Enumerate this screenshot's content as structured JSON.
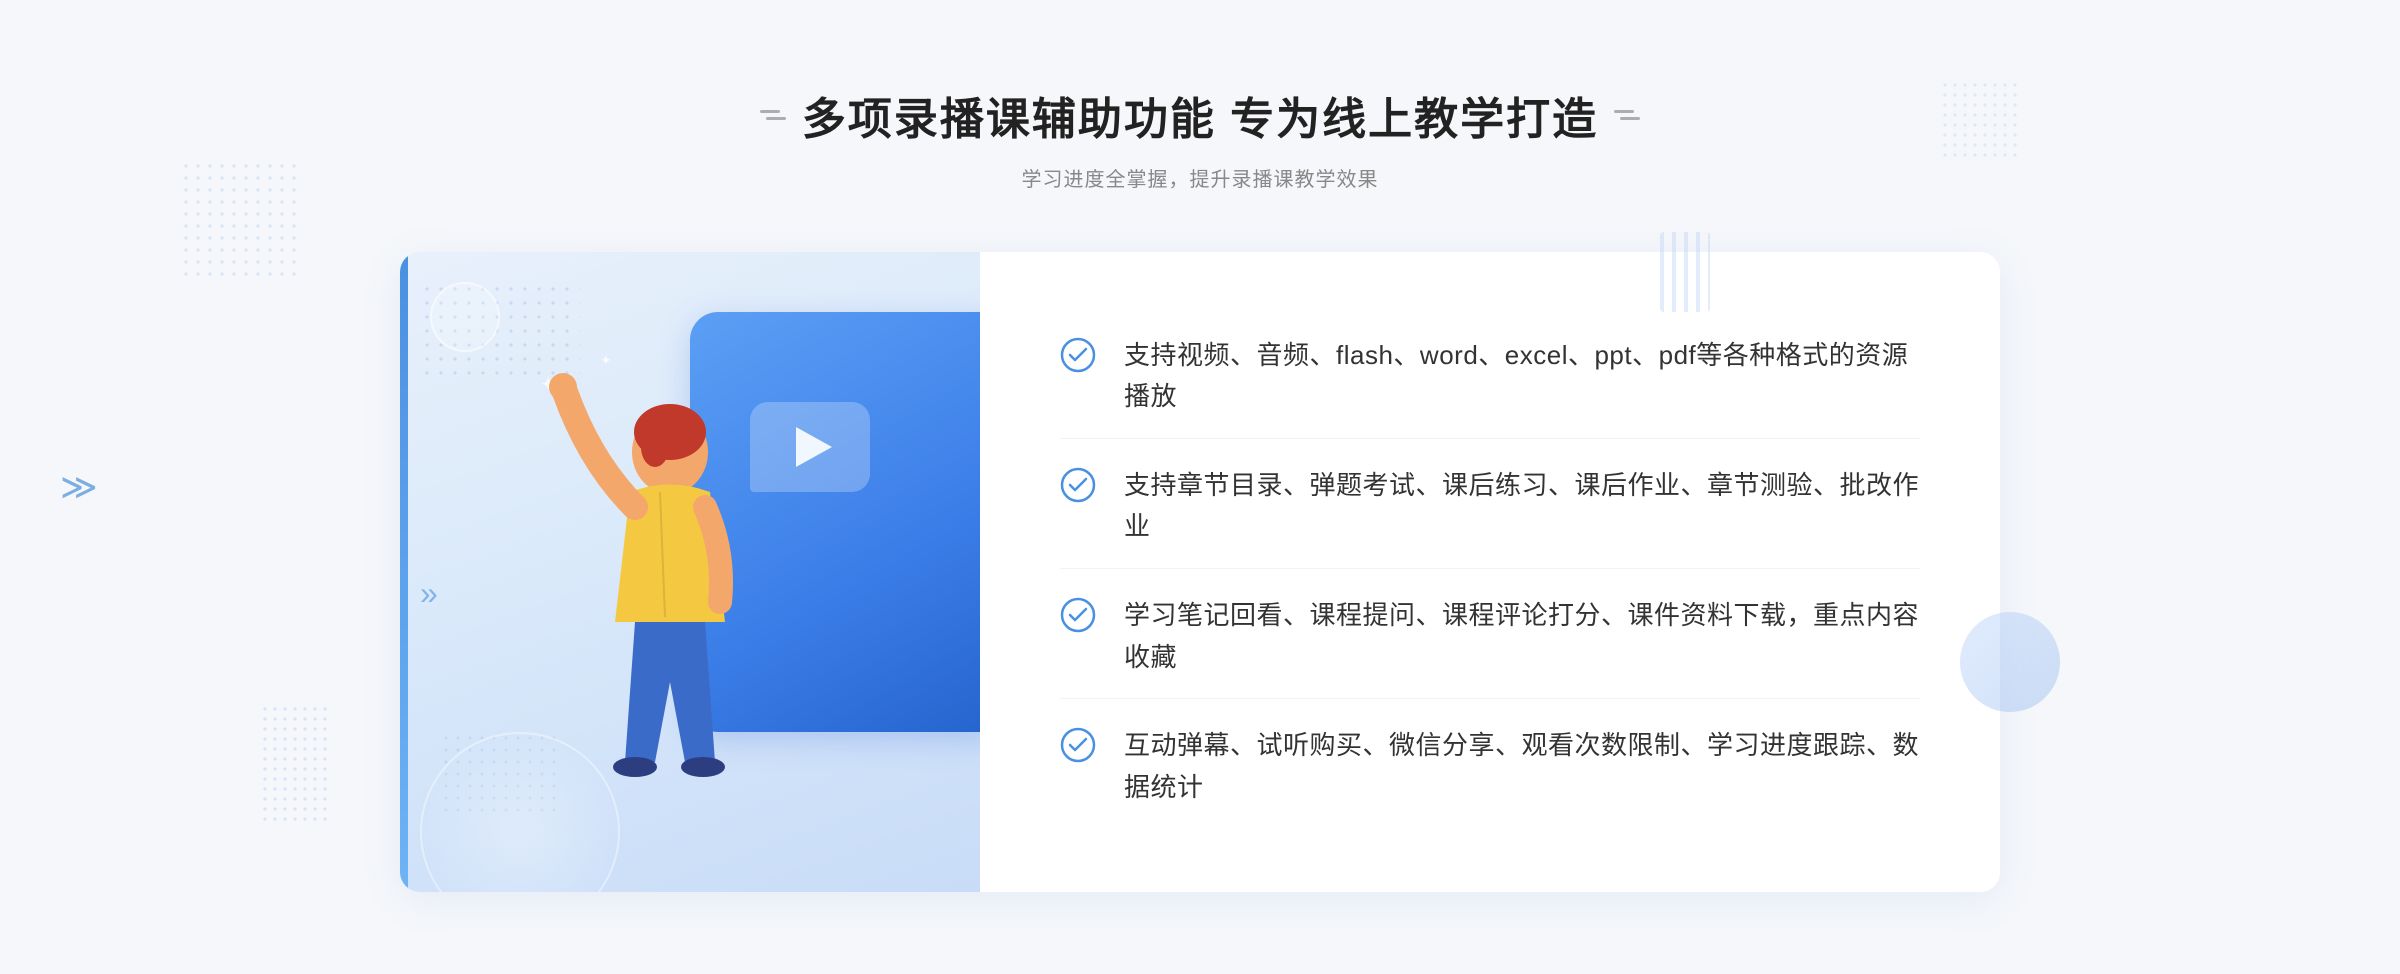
{
  "header": {
    "title": "多项录播课辅助功能 专为线上教学打造",
    "subtitle": "学习进度全掌握，提升录播课教学效果",
    "decorator_label": "decoration"
  },
  "features": [
    {
      "id": "feature-1",
      "text": "支持视频、音频、flash、word、excel、ppt、pdf等各种格式的资源播放"
    },
    {
      "id": "feature-2",
      "text": "支持章节目录、弹题考试、课后练习、课后作业、章节测验、批改作业"
    },
    {
      "id": "feature-3",
      "text": "学习笔记回看、课程提问、课程评论打分、课件资料下载，重点内容收藏"
    },
    {
      "id": "feature-4",
      "text": "互动弹幕、试听购买、微信分享、观看次数限制、学习进度跟踪、数据统计"
    }
  ],
  "check_icon_color": "#4a90e2",
  "accent_blue": "#3b7de8",
  "light_blue": "#e8f0fb"
}
